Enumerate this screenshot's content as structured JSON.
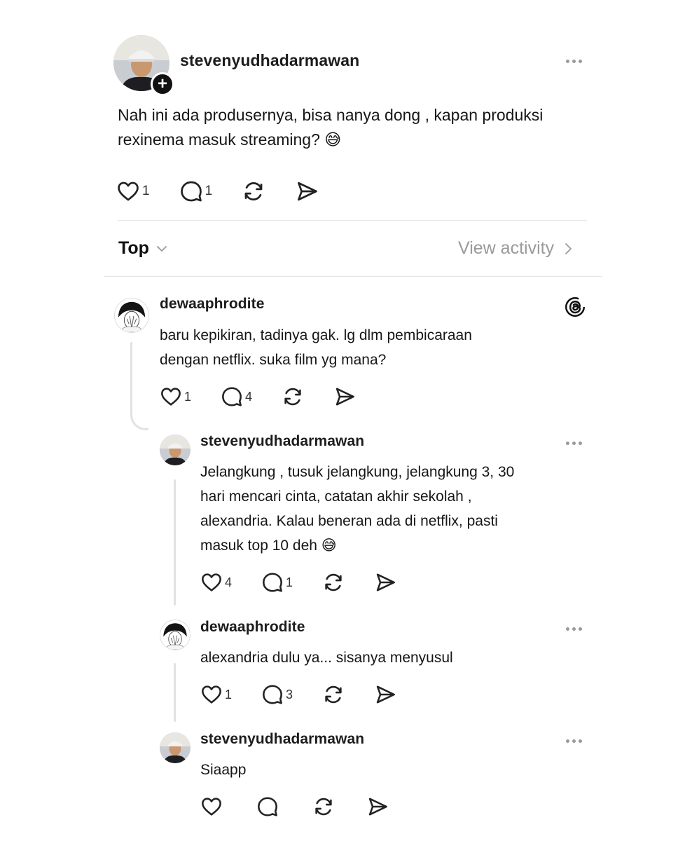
{
  "original_post": {
    "username": "stevenyudhadarmawan",
    "text_line1": "Nah ini ada produsernya, bisa nanya dong , kapan produksi",
    "text_line2": "rexinema  masuk streaming? 😅",
    "likes": "1",
    "replies": "1"
  },
  "sort_bar": {
    "sort_label": "Top",
    "view_activity_label": "View activity"
  },
  "replies": [
    {
      "username": "dewaaphrodite",
      "lines": [
        "baru kepikiran, tadinya gak. lg dlm pembicaraan",
        "dengan netflix. suka film yg mana?"
      ],
      "likes": "1",
      "replies": "4",
      "badge_icon": "threads-logo-icon"
    },
    {
      "username": "stevenyudhadarmawan",
      "lines": [
        "Jelangkung , tusuk jelangkung, jelangkung 3, 30",
        "hari mencari cinta, catatan akhir sekolah ,",
        "alexandria. Kalau beneran ada di netflix, pasti",
        "masuk top 10 deh 😅"
      ],
      "likes": "4",
      "replies": "1"
    },
    {
      "username": "dewaaphrodite",
      "lines": [
        "alexandria dulu ya... sisanya menyusul"
      ],
      "likes": "1",
      "replies": "3"
    },
    {
      "username": "stevenyudhadarmawan",
      "lines": [
        "Siaapp"
      ],
      "likes": "",
      "replies": ""
    }
  ],
  "icons": {
    "like": "heart-icon",
    "reply": "comment-icon",
    "repost": "repost-icon",
    "share": "send-icon",
    "more": "more-options-icon",
    "follow": "plus-icon",
    "sort_caret": "chevron-down-icon",
    "activity_arrow": "chevron-right-icon"
  },
  "colors": {
    "text": "#161616",
    "muted": "#9a9a9a",
    "thread_line": "#e2e2e2"
  }
}
